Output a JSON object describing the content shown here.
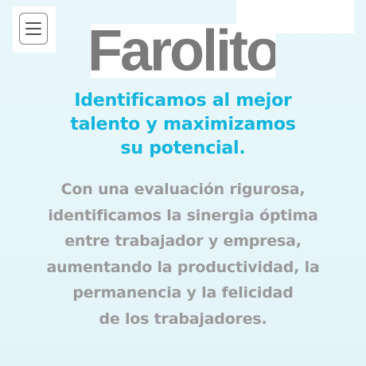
{
  "header": {
    "menu_icon": "hamburger-menu-icon",
    "logo_text": "Farolito"
  },
  "hero": {
    "headline_lines": [
      "Identificamos al mejor",
      "talento y maximizamos",
      "su potencial."
    ],
    "body_lines": [
      "Con una evaluación rigurosa,",
      "identificamos la sinergia óptima",
      "entre trabajador y empresa,",
      "aumentando la productividad, la",
      "permanencia y la felicidad",
      "de los trabajadores."
    ]
  },
  "colors": {
    "accent": "#12b5dd",
    "logo": "#7a7a7a",
    "body_text": "#9a9a9a",
    "background": "#e6f5f8"
  }
}
